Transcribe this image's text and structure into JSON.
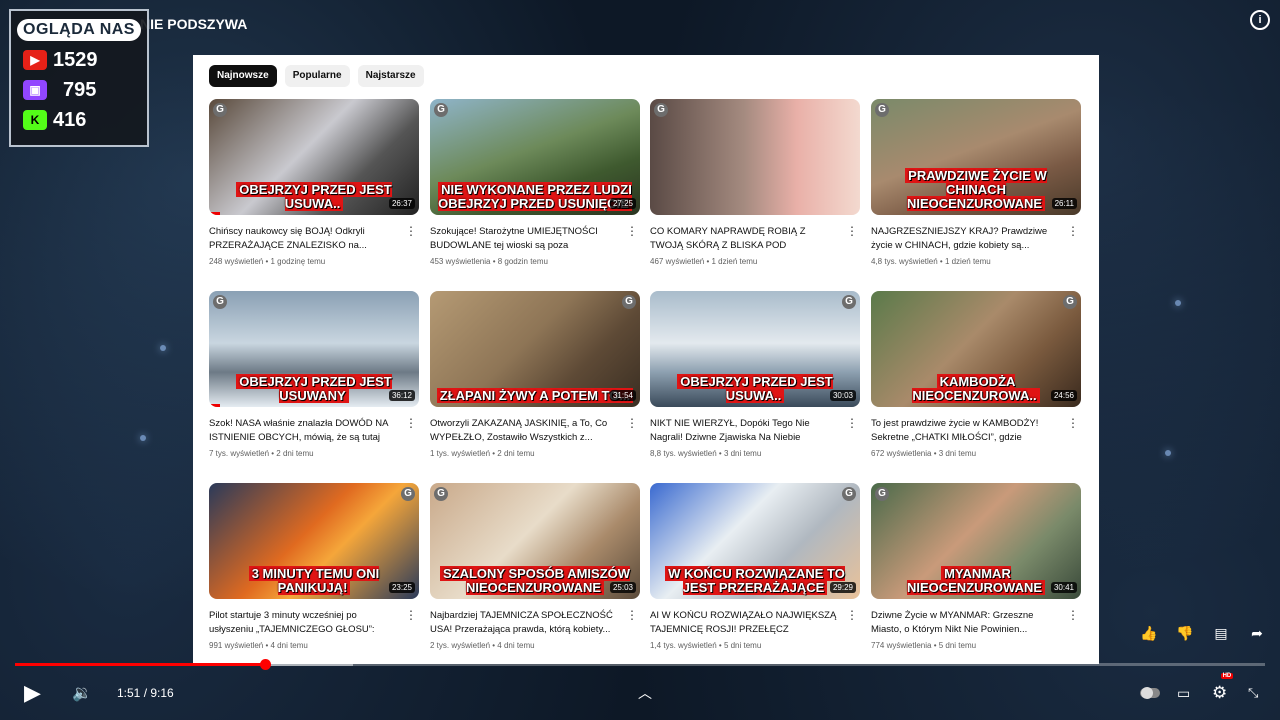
{
  "window": {
    "title": "NIE PODSZYWA"
  },
  "viewer_counter": {
    "title": "OGLĄDA NAS",
    "platforms": [
      {
        "icon": "youtube-icon",
        "count": "1529",
        "color": "#e62117"
      },
      {
        "icon": "twitch-icon",
        "count": "795",
        "color": "#9146ff"
      },
      {
        "icon": "kick-icon",
        "count": "416",
        "color": "#53fc18"
      }
    ]
  },
  "filters": [
    {
      "label": "Najnowsze",
      "active": true
    },
    {
      "label": "Popularne",
      "active": false
    },
    {
      "label": "Najstarsze",
      "active": false
    }
  ],
  "videos": [
    {
      "caption": "OBEJRZYJ PRZED JEST USUWA..",
      "duration": "26:37",
      "title": "Chińscy naukowcy się BOJĄ! Odkryli PRZERAŻAJĄCE ZNALEZISKO na...",
      "meta": "248 wyświetleń • 1 godzinę temu",
      "bg": "linear-gradient(135deg,#5a4a3c,#c9c9cf 45%,#555 70%,#222)",
      "watched": 0.05
    },
    {
      "caption": "NIE WYKONANE PRZEZ LUDZI OBEJRZYJ PRZED USUNIĘCIE",
      "duration": "27:25",
      "title": "Szokujące! Starożytne UMIEJĘTNOŚCI BUDOWLANE tej wioski są poza zasięgiem...",
      "meta": "453 wyświetlenia • 8 godzin temu",
      "bg": "linear-gradient(160deg,#8fb4c9,#6d8a5a 45%,#3f5a2f 70%,#2a3420)",
      "watched": 0
    },
    {
      "caption": "",
      "duration": "",
      "title": "CO KOMARY NAPRAWDĘ ROBIĄ Z TWOJĄ SKÓRĄ Z BLISKA POD MIKROSKOPEM...",
      "meta": "467 wyświetleń • 1 dzień temu",
      "bg": "linear-gradient(90deg,#5a4a45,#a58b80 45%,#e9b0a8 70%,#f3d9cf)",
      "watched": 0
    },
    {
      "caption": "PRAWDZIWE ŻYCIE W CHINACH NIEOCENZUROWANE",
      "duration": "26:11",
      "title": "NAJGRZESZNIEJSZY KRAJ? Prawdziwe życie w CHINACH, gdzie kobiety są...",
      "meta": "4,8 tys. wyświetleń • 1 dzień temu",
      "bg": "linear-gradient(160deg,#7a8a6a,#a88a6e 45%,#7a5a45 70%,#4a3a2a)",
      "watched": 0
    },
    {
      "caption": "OBEJRZYJ PRZED JEST USUWANY",
      "duration": "36:12",
      "title": "Szok! NASA właśnie znalazła DOWÓD NA ISTNIENIE OBCYCH, mówią, że są tutaj od...",
      "meta": "7 tys. wyświetleń • 2 dni temu",
      "bg": "linear-gradient(180deg,#8aa0b4,#c9d6e0 45%,#6d7a86 70%,#e5ecf2)",
      "watched": 0.05
    },
    {
      "caption": "ZŁAPANI ŻYWY A POTEM TO...",
      "duration": "31:54",
      "title": "Otworzyli ZAKAZANĄ JASKINIĘ, a To, Co WYPEŁZŁO, Zostawiło Wszystkich z...",
      "meta": "1 tys. wyświetleń • 2 dni temu",
      "bg": "linear-gradient(135deg,#b59a74,#8e7556 45%,#5e4a36 70%,#3a2e22)",
      "watched": 0
    },
    {
      "caption": "OBEJRZYJ PRZED JEST USUWA..",
      "duration": "30:03",
      "title": "NIKT NIE WIERZYŁ, Dopóki Tego Nie Nagrali! Dziwne Zjawiska Na Niebie Wstrząsnęły...",
      "meta": "8,8 tys. wyświetleń • 3 dni temu",
      "bg": "linear-gradient(180deg,#a9bccb,#e3e9ee 45%,#8da0b0 70%,#3a4a5a)",
      "watched": 0
    },
    {
      "caption": "KAMBODŻA NIEOCENZUROWA..",
      "duration": "24:56",
      "title": "To jest prawdziwe życie w KAMBODŻY! Sekretne „CHATKI MIŁOŚCI”, gdzie kobiety...",
      "meta": "672 wyświetlenia • 3 dni temu",
      "bg": "linear-gradient(135deg,#5a7a4a,#a98a6a 45%,#7a5a3e 70%,#3a2a1e)",
      "watched": 0
    },
    {
      "caption": "3 MINUTY TEMU ONI PANIKUJĄ!",
      "duration": "23:25",
      "title": "Pilot startuje 3 minuty wcześniej po usłyszeniu „TAJEMNICZEGO GŁOSU”: Ratu...",
      "meta": "991 wyświetleń • 4 dni temu",
      "bg": "linear-gradient(135deg,#2a3a5a,#e06a20 45%,#f5a63a 60%,#2a3a5a)",
      "watched": 0
    },
    {
      "caption": "SZALONY SPOSÓB AMISZÓW NIEOCENZUROWANE",
      "duration": "25:03",
      "title": "Najbardziej TAJEMNICZA SPOŁECZNOŚĆ USA! Przerażająca prawda, którą kobiety...",
      "meta": "2 tys. wyświetleń • 4 dni temu",
      "bg": "linear-gradient(135deg,#c9a98a,#e8dcc9 45%,#a98a6a 70%,#5a4a3a)",
      "watched": 0
    },
    {
      "caption": "W KOŃCU ROZWIĄZANE TO JEST PRZERAŻAJĄCE",
      "duration": "29:29",
      "title": "AI W KOŃCU ROZWIĄZAŁO NAJWIĘKSZĄ TAJEMNICĘ ROSJI! PRZEŁĘCZ DYATŁOWA...",
      "meta": "1,4 tys. wyświetleń • 5 dni temu",
      "bg": "linear-gradient(135deg,#3a6ad0,#e8eef2 40%,#b0b8c0 65%,#e9c29a)",
      "watched": 0
    },
    {
      "caption": "MYANMAR NIEOCENZUROWANE",
      "duration": "30:41",
      "title": "Dziwne Życie w MYANMAR: Grzeszne Miasto, o Którym Nikt Nie Powinien...",
      "meta": "774 wyświetlenia • 5 dni temu",
      "bg": "linear-gradient(135deg,#4a6a4a,#c99a7a 45%,#7a8a6a 70%,#3a4a3a)",
      "watched": 0
    }
  ],
  "player": {
    "current_time": "1:51",
    "duration": "9:16",
    "time_display": "1:51 / 9:16",
    "progress": 0.2,
    "buffered": 0.27
  },
  "side_actions": [
    "like-icon",
    "dislike-icon",
    "comment-icon",
    "share-icon"
  ],
  "hd_badge": "HD"
}
